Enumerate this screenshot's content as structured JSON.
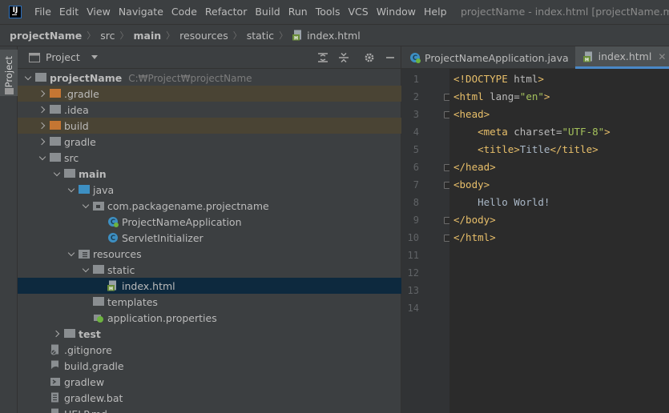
{
  "menubar": {
    "items": [
      "File",
      "Edit",
      "View",
      "Navigate",
      "Code",
      "Refactor",
      "Build",
      "Run",
      "Tools",
      "VCS",
      "Window",
      "Help"
    ],
    "window_title": "projectName - index.html [projectName.main]"
  },
  "breadcrumb": [
    "projectName",
    "src",
    "main",
    "resources",
    "static",
    "index.html"
  ],
  "side_strip": {
    "tab_label": "Project"
  },
  "project_panel": {
    "title": "Project",
    "tree": [
      {
        "label": "projectName",
        "hint": "C:₩Project₩projectName",
        "bold": true,
        "depth": 0,
        "arrow": "down",
        "icon": "folder-gray"
      },
      {
        "label": ".gradle",
        "depth": 1,
        "arrow": "right",
        "icon": "folder-orange",
        "excluded": true
      },
      {
        "label": ".idea",
        "depth": 1,
        "arrow": "right",
        "icon": "folder-gray"
      },
      {
        "label": "build",
        "depth": 1,
        "arrow": "right",
        "icon": "folder-orange",
        "excluded": true
      },
      {
        "label": "gradle",
        "depth": 1,
        "arrow": "right",
        "icon": "folder-gray"
      },
      {
        "label": "src",
        "depth": 1,
        "arrow": "down",
        "icon": "folder-gray"
      },
      {
        "label": "main",
        "bold": true,
        "depth": 2,
        "arrow": "down",
        "icon": "folder-gray"
      },
      {
        "label": "java",
        "depth": 3,
        "arrow": "down",
        "icon": "folder-blue"
      },
      {
        "label": "com.packagename.projectname",
        "depth": 4,
        "arrow": "down",
        "icon": "package"
      },
      {
        "label": "ProjectNameApplication",
        "depth": 5,
        "arrow": "",
        "icon": "spring-class"
      },
      {
        "label": "ServletInitializer",
        "depth": 5,
        "arrow": "",
        "icon": "class"
      },
      {
        "label": "resources",
        "depth": 3,
        "arrow": "down",
        "icon": "resources-folder"
      },
      {
        "label": "static",
        "depth": 4,
        "arrow": "down",
        "icon": "folder-gray"
      },
      {
        "label": "index.html",
        "depth": 5,
        "arrow": "",
        "icon": "html-file",
        "selected": true
      },
      {
        "label": "templates",
        "depth": 4,
        "arrow": "",
        "icon": "folder-gray"
      },
      {
        "label": "application.properties",
        "depth": 4,
        "arrow": "",
        "icon": "spring-properties"
      },
      {
        "label": "test",
        "bold": true,
        "depth": 2,
        "arrow": "right",
        "icon": "folder-gray"
      },
      {
        "label": ".gitignore",
        "depth": 1,
        "arrow": "",
        "icon": "gitignore-file"
      },
      {
        "label": "build.gradle",
        "depth": 1,
        "arrow": "",
        "icon": "gradle-file"
      },
      {
        "label": "gradlew",
        "depth": 1,
        "arrow": "",
        "icon": "shell-file"
      },
      {
        "label": "gradlew.bat",
        "depth": 1,
        "arrow": "",
        "icon": "bat-file"
      },
      {
        "label": "HELP.md",
        "depth": 1,
        "arrow": "",
        "icon": "md-file"
      }
    ]
  },
  "editor": {
    "tabs": [
      {
        "label": "ProjectNameApplication.java",
        "icon": "spring-class",
        "active": false,
        "closable": false
      },
      {
        "label": "index.html",
        "icon": "html-file",
        "active": true,
        "closable": true
      }
    ],
    "close_glyph": "✕",
    "line_numbers": [
      "1",
      "2",
      "3",
      "4",
      "5",
      "6",
      "7",
      "8",
      "9",
      "10",
      "11",
      "12",
      "13",
      "14"
    ],
    "code_lines": [
      [
        {
          "t": "<!DOCTYPE ",
          "c": "tag"
        },
        {
          "t": "html",
          "c": "attr"
        },
        {
          "t": ">",
          "c": "tag"
        }
      ],
      [
        {
          "t": "<html ",
          "c": "tag"
        },
        {
          "t": "lang=",
          "c": "attr"
        },
        {
          "t": "\"en\"",
          "c": "val"
        },
        {
          "t": ">",
          "c": "tag"
        }
      ],
      [
        {
          "t": "<head>",
          "c": "tag"
        }
      ],
      [
        {
          "t": "    <meta ",
          "c": "tag"
        },
        {
          "t": "charset=",
          "c": "attr"
        },
        {
          "t": "\"UTF-8\"",
          "c": "val"
        },
        {
          "t": ">",
          "c": "tag"
        }
      ],
      [
        {
          "t": "    <title>",
          "c": "tag"
        },
        {
          "t": "Title",
          "c": "text"
        },
        {
          "t": "</title>",
          "c": "tag"
        }
      ],
      [
        {
          "t": "</head>",
          "c": "tag"
        }
      ],
      [
        {
          "t": "<body>",
          "c": "tag"
        }
      ],
      [
        {
          "t": "    Hello World!",
          "c": "text"
        }
      ],
      [
        {
          "t": "</body>",
          "c": "tag"
        }
      ],
      [
        {
          "t": "</html>",
          "c": "tag"
        }
      ],
      [],
      [],
      [],
      []
    ]
  },
  "colors": {
    "accent": "#4a88c7",
    "selection": "#0d293e",
    "excluded": "#4a4434",
    "tag": "#e8bf6a",
    "value": "#a5c25c"
  }
}
